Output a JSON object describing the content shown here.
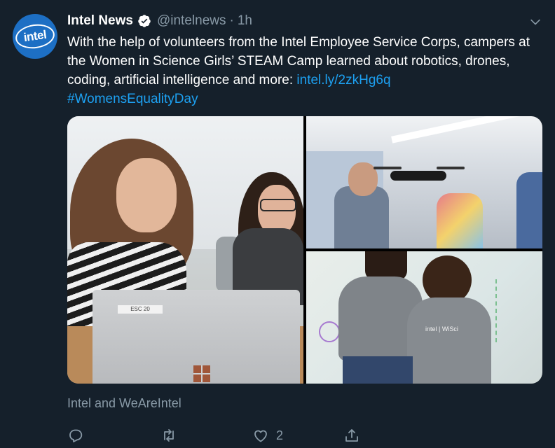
{
  "author": {
    "name": "Intel News",
    "handle": "@intelnews",
    "separator": "·",
    "time": "1h",
    "avatar_text": "intel"
  },
  "tweet": {
    "text": "With the help of volunteers from the Intel Employee Service Corps, campers at the Women in Science Girls’ STEAM Camp learned about robotics, drones, coding, artificial intelligence and more: ",
    "link": "intel.ly/2zkHg6q",
    "hashtag": "#WomensEqualityDay"
  },
  "media": {
    "main_tag": "ESC 20",
    "shirt_logo": "intel | WiSci"
  },
  "attribution": "Intel and WeAreIntel",
  "actions": {
    "like_count": "2"
  },
  "colors": {
    "background": "#15202b",
    "accent": "#1da1f2",
    "muted": "#8899a6",
    "avatar": "#1d6fc4"
  },
  "icons": [
    "verified-badge-icon",
    "chevron-down-icon",
    "reply-icon",
    "retweet-icon",
    "like-icon",
    "share-icon"
  ]
}
